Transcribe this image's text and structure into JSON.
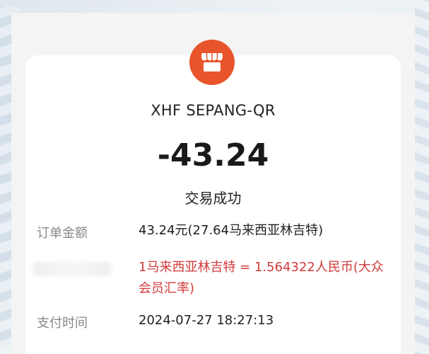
{
  "receipt": {
    "merchant_name": "XHF SEPANG-QR",
    "amount": "-43.24",
    "status": "交易成功",
    "details": [
      {
        "label": "订单金额",
        "value": "43.24元(27.64马来西亚林吉特)"
      },
      {
        "label": "",
        "value": "1马来西亚林吉特 = 1.564322人民币(大众会员汇率)"
      },
      {
        "label": "支付时间",
        "value": "2024-07-27 18:27:13"
      }
    ]
  },
  "icons": {
    "merchant_logo": "storefront-icon"
  },
  "colors": {
    "logo_bg": "#e8542b",
    "rate_text": "#d23a3a",
    "label_text": "#888888",
    "page_bg": "#f4f4f4"
  }
}
